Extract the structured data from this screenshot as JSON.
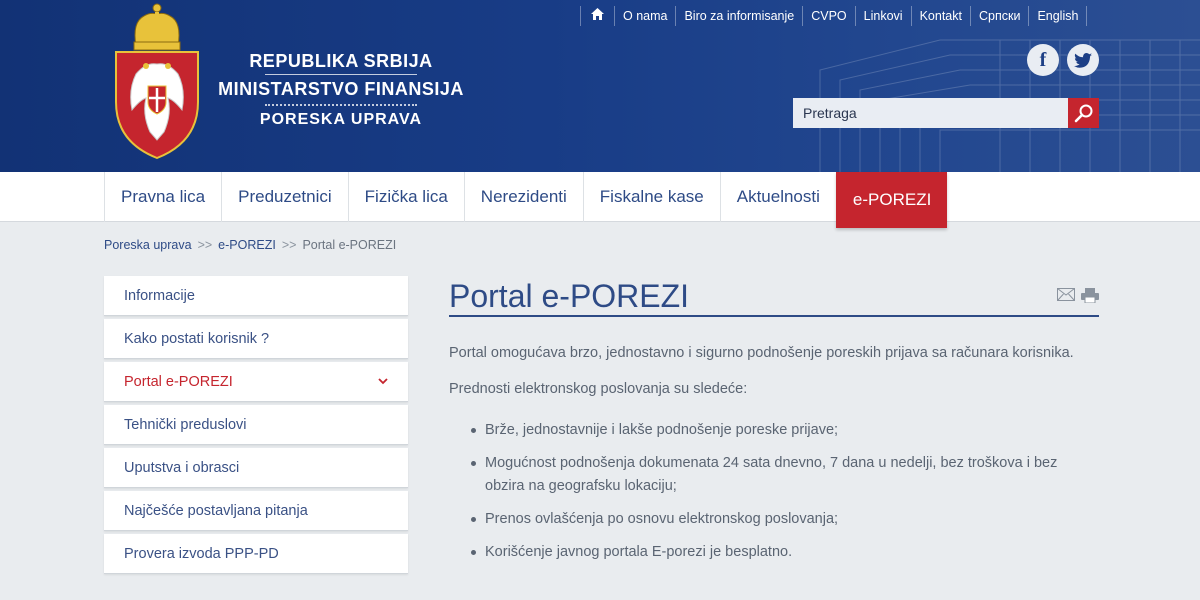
{
  "header": {
    "line1": "Republika Srbija",
    "line2": "Ministarstvo Finansija",
    "line3": "Poreska uprava",
    "brand_color": "#1a3a80",
    "accent_color": "#c5252e"
  },
  "topnav": {
    "home_icon": "home-icon",
    "items": [
      "O nama",
      "Biro za informisanje",
      "CVPO",
      "Linkovi",
      "Kontakt",
      "Српски",
      "English"
    ]
  },
  "social": {
    "facebook_label": "f",
    "twitter_icon": "twitter-icon"
  },
  "search": {
    "placeholder": "Pretraga",
    "button_icon": "search-icon"
  },
  "mainnav": {
    "items": [
      "Pravna lica",
      "Preduzetnici",
      "Fizička lica",
      "Nerezidenti",
      "Fiskalne kase",
      "Aktuelnosti",
      "e-POREZI"
    ],
    "active_index": 6
  },
  "breadcrumb": {
    "items": [
      "Poreska uprava",
      "e-POREZI",
      "Portal e-POREZI"
    ],
    "separator": ">>"
  },
  "sidebar": {
    "items": [
      "Informacije",
      "Kako postati korisnik ?",
      "Portal e-POREZI",
      "Tehnički preduslovi",
      "Uputstva i obrasci",
      "Najčešće postavljana pitanja",
      "Provera izvoda PPP-PD"
    ],
    "active_index": 2
  },
  "content": {
    "title": "Portal e-POREZI",
    "intro": "Portal omogućava brzo, jednostavno i sigurno podnošenje poreskih  prijava sa računara korisnika.",
    "advantages_heading": "Prednosti elektronskog poslovanja su sledeće:",
    "bullets": [
      "Brže, jednostavnije i lakše podnošenje poreske prijave;",
      "Mogućnost podnošenja dokumenata 24 sata dnevno, 7 dana u nedelji, bez troškova i bez obzira na geografsku lokaciju;",
      "Prenos ovlašćenja po osnovu elektronskog poslovanja;",
      "Korišćenje javnog portala E-porezi je besplatno."
    ],
    "tool_icons": [
      "email-icon",
      "print-icon"
    ]
  }
}
